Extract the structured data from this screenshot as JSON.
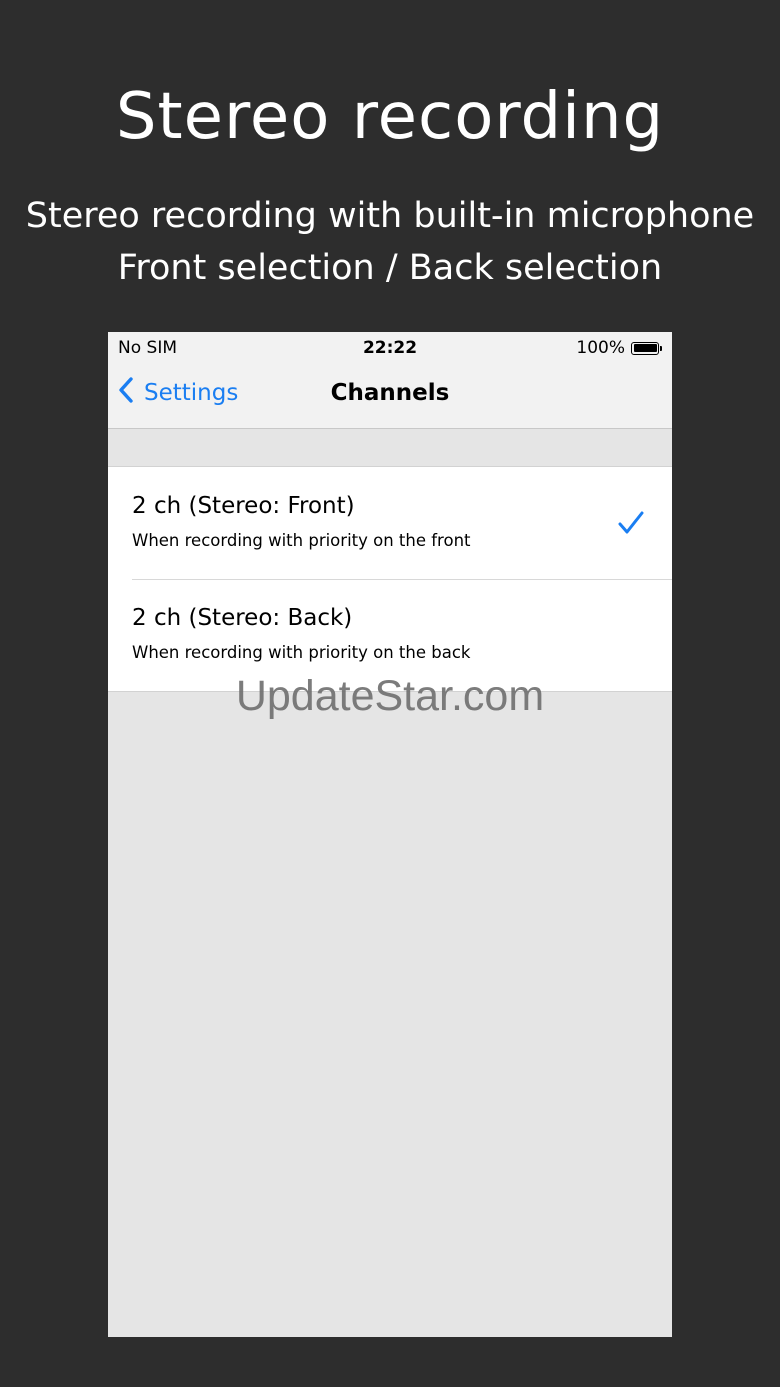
{
  "promo": {
    "title": "Stereo recording",
    "subtitle_line1": "Stereo recording with built-in microphone",
    "subtitle_line2": "Front selection / Back selection"
  },
  "status_bar": {
    "carrier": "No SIM",
    "time": "22:22",
    "battery": "100%"
  },
  "nav": {
    "back_label": "Settings",
    "title": "Channels"
  },
  "options": [
    {
      "title": "2 ch (Stereo: Front)",
      "subtitle": "When recording with priority on the front",
      "selected": true
    },
    {
      "title": "2 ch (Stereo: Back)",
      "subtitle": "When recording with priority on the back",
      "selected": false
    }
  ],
  "watermark": "UpdateStar.com",
  "colors": {
    "accent": "#1a7ef2",
    "background": "#2d2d2d"
  },
  "icons": {
    "back": "chevron-left-icon",
    "selected": "checkmark-icon",
    "battery": "battery-icon"
  }
}
